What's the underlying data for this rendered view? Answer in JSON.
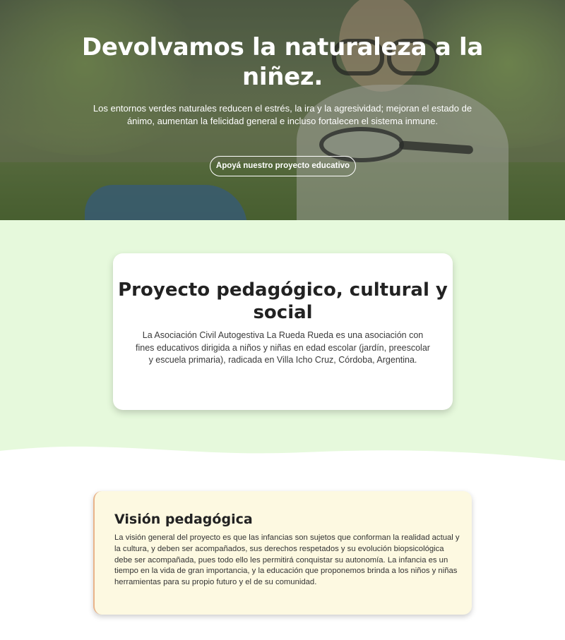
{
  "hero": {
    "title": "Devolvamos la naturaleza a la niñez.",
    "subtitle": "Los entornos verdes naturales reducen el estrés, la ira y la agresividad; mejoran el estado de ánimo, aumentan la felicidad general e incluso fortalecen el sistema inmune.",
    "cta_label": "Apoyá nuestro proyecto educativo"
  },
  "project": {
    "title": "Proyecto pedagógico, cultural y social",
    "description": "La Asociación Civil Autogestiva La Rueda Rueda es una asociación con fines educativos dirigida a niños y niñas en edad escolar (jardín, preescolar y escuela primaria), radicada en Villa Icho Cruz, Córdoba, Argentina."
  },
  "vision": {
    "title": "Visión pedagógica",
    "text": "La visión general del proyecto es que las infancias son sujetos que conforman la realidad actual y la cultura, y deben ser acompañados, sus derechos respetados y su evolución biopsicológica debe ser acompañada, pues todo ello les permitirá conquistar su autonomía. La infancia es un tiempo en la vida de gran importancia, y la educación que proponemos brinda a los niños y niñas herramientas para su propio futuro y el de su comunidad."
  },
  "colors": {
    "green_section": "#e6f9dc",
    "vision_bg": "#fdf9e1",
    "vision_accent": "#e9b48a"
  }
}
